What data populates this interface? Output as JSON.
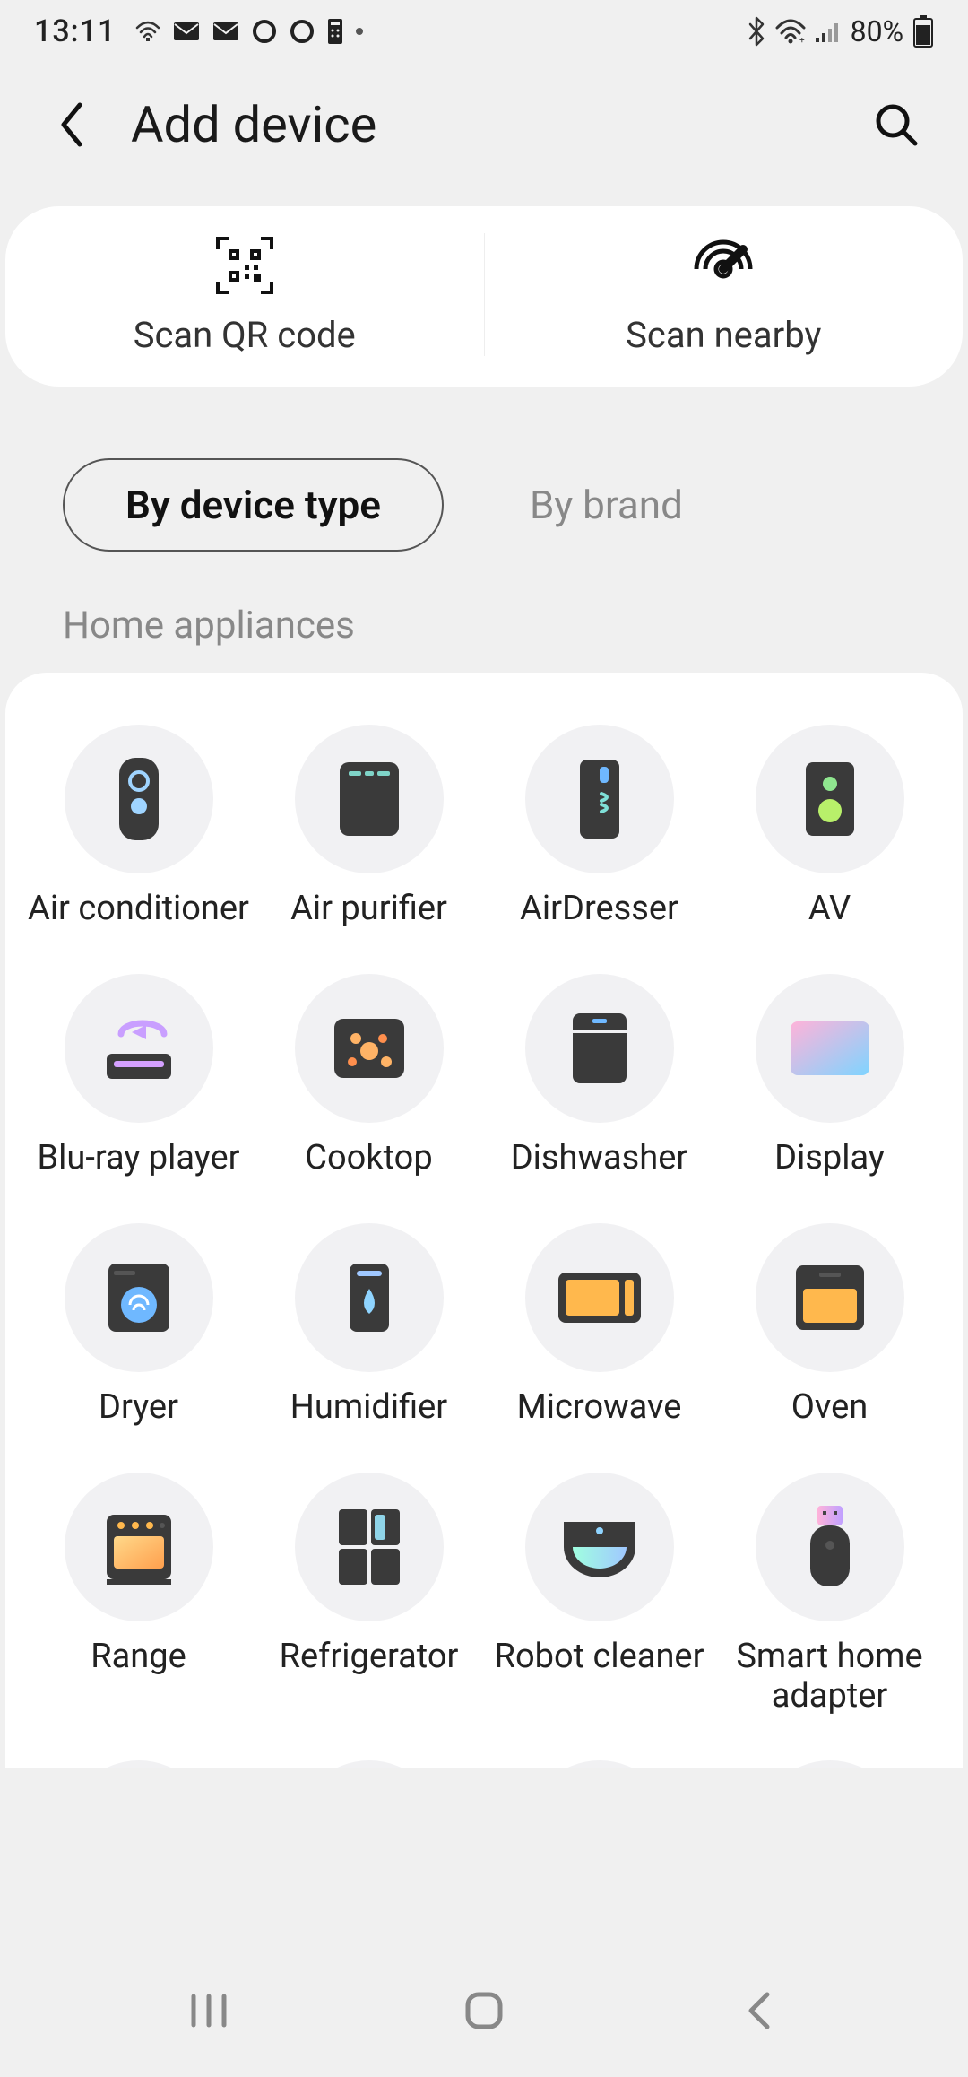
{
  "status": {
    "time": "13:11",
    "battery_text": "80%"
  },
  "header": {
    "title": "Add device"
  },
  "scan": {
    "items": [
      {
        "label": "Scan QR code"
      },
      {
        "label": "Scan nearby"
      }
    ]
  },
  "tabs": {
    "active": "By device type",
    "inactive": "By brand"
  },
  "section": {
    "title": "Home appliances"
  },
  "devices": [
    {
      "label": "Air conditioner",
      "name": "air-conditioner"
    },
    {
      "label": "Air purifier",
      "name": "air-purifier"
    },
    {
      "label": "AirDresser",
      "name": "airdresser"
    },
    {
      "label": "AV",
      "name": "av"
    },
    {
      "label": "Blu-ray player",
      "name": "blu-ray-player"
    },
    {
      "label": "Cooktop",
      "name": "cooktop"
    },
    {
      "label": "Dishwasher",
      "name": "dishwasher"
    },
    {
      "label": "Display",
      "name": "display"
    },
    {
      "label": "Dryer",
      "name": "dryer"
    },
    {
      "label": "Humidifier",
      "name": "humidifier"
    },
    {
      "label": "Microwave",
      "name": "microwave"
    },
    {
      "label": "Oven",
      "name": "oven"
    },
    {
      "label": "Range",
      "name": "range"
    },
    {
      "label": "Refrigerator",
      "name": "refrigerator"
    },
    {
      "label": "Robot cleaner",
      "name": "robot-cleaner"
    },
    {
      "label": "Smart home adapter",
      "name": "smart-home-adapter"
    }
  ]
}
